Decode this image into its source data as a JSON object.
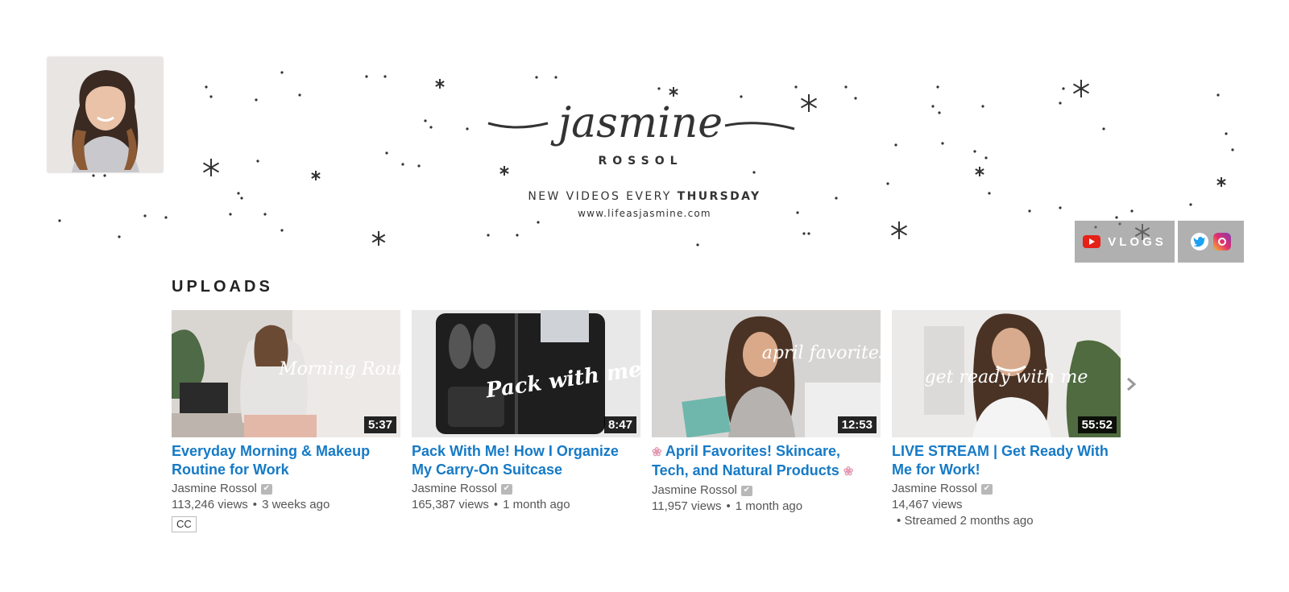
{
  "banner": {
    "logo_script": "jasmine",
    "logo_sub": "ROSSOL",
    "tagline_prefix": "NEW VIDEOS EVERY",
    "tagline_day": "THURSDAY",
    "website": "www.lifeasjasmine.com",
    "links": {
      "vlogs_label": "VLOGS",
      "vlogs_icon": "youtube-icon",
      "social_icons": [
        "twitter-icon",
        "instagram-icon"
      ]
    }
  },
  "section": {
    "title": "UPLOADS"
  },
  "videos": [
    {
      "title": "Everyday Morning & Makeup Routine for Work",
      "channel": "Jasmine Rossol",
      "views": "113,246 views",
      "age": "3 weeks ago",
      "duration": "5:37",
      "badge": "CC",
      "thumb_text": "Morning Routine"
    },
    {
      "title": "Pack With Me! How I Organize My Carry-On Suitcase",
      "channel": "Jasmine Rossol",
      "views": "165,387 views",
      "age": "1 month ago",
      "duration": "8:47",
      "thumb_text": "Pack with me"
    },
    {
      "title": "April Favorites! Skincare, Tech, and Natural Products",
      "title_emoji": "❀",
      "channel": "Jasmine Rossol",
      "views": "11,957 views",
      "age": "1 month ago",
      "duration": "12:53",
      "thumb_text": "april favorites"
    },
    {
      "title": "LIVE STREAM | Get Ready With Me for Work!",
      "channel": "Jasmine Rossol",
      "views": "14,467 views",
      "age": "Streamed 2 months ago",
      "duration": "55:52",
      "thumb_text": "get ready with me"
    }
  ],
  "icons": {
    "verified": "✔",
    "next": "chevron-right-icon"
  },
  "colors": {
    "link": "#167ac6",
    "youtube_red": "#e62117"
  }
}
